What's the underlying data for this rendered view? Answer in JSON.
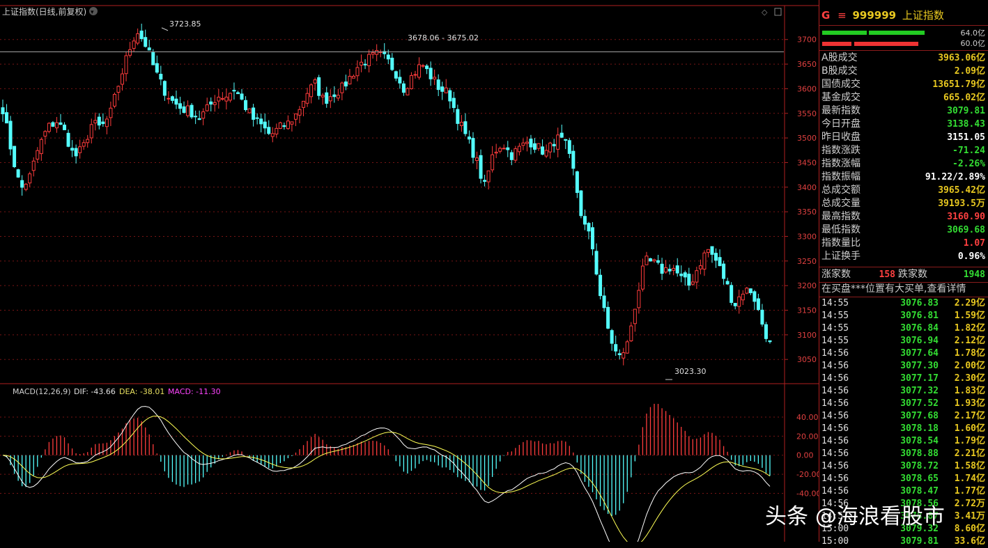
{
  "chart_header": {
    "title": "上证指数(日线,前复权)",
    "price_labels": {
      "high": "3723.85",
      "range": "3678.06 - 3675.02",
      "low": "3023.30"
    }
  },
  "macd_header": {
    "name": "MACD(12,26,9)",
    "dif": "DIF: -43.66",
    "dea": "DEA: -38.01",
    "macd": "MACD: -11.30"
  },
  "colors": {
    "up": "#ff3c3c",
    "down": "#54ffff",
    "dif": "#ffffff",
    "dea": "#ffff55",
    "grid": "#7a1515",
    "macd_label": "#ff44ff"
  },
  "chart_data": [
    {
      "type": "candlestick",
      "title": "上证指数(日线,前复权)",
      "y_ticks": [
        3050,
        3100,
        3150,
        3200,
        3250,
        3300,
        3350,
        3400,
        3450,
        3500,
        3550,
        3600,
        3650,
        3700
      ],
      "ylim": [
        3005,
        3735
      ],
      "annotations": {
        "high": 3723.85,
        "low": 3023.3,
        "reference": 3675.02
      },
      "close_path": [
        3560,
        3470,
        3395,
        3420,
        3480,
        3520,
        3535,
        3510,
        3460,
        3480,
        3530,
        3520,
        3545,
        3610,
        3670,
        3720,
        3690,
        3640,
        3600,
        3575,
        3560,
        3555,
        3540,
        3560,
        3585,
        3585,
        3600,
        3570,
        3540,
        3525,
        3505,
        3520,
        3530,
        3550,
        3590,
        3610,
        3575,
        3590,
        3600,
        3625,
        3650,
        3660,
        3670,
        3660,
        3635,
        3600,
        3630,
        3650,
        3625,
        3600,
        3590,
        3540,
        3500,
        3460,
        3400,
        3470,
        3490,
        3465,
        3480,
        3495,
        3480,
        3470,
        3500,
        3490,
        3430,
        3330,
        3290,
        3180,
        3100,
        3050,
        3080,
        3170,
        3250,
        3245,
        3230,
        3240,
        3215,
        3200,
        3240,
        3275,
        3250,
        3210,
        3160,
        3190,
        3190,
        3130,
        3080
      ]
    },
    {
      "type": "macd",
      "name": "MACD(12,26,9)",
      "y_ticks": [
        40,
        20,
        0,
        -20,
        -40
      ],
      "ylim": [
        -85,
        70
      ],
      "dif_last": -43.66,
      "dea_last": -38.01,
      "macd_last": -11.3
    }
  ],
  "panel": {
    "code_prefix": "G",
    "code": "999999",
    "name": "上证指数",
    "bar_values": [
      "64.0亿",
      "60.0亿"
    ],
    "stats": [
      {
        "label": "A股成交",
        "value": "3963.06亿",
        "color": "#e8c820"
      },
      {
        "label": "B股成交",
        "value": "2.09亿",
        "color": "#e8c820"
      },
      {
        "label": "国债成交",
        "value": "13651.79亿",
        "color": "#e8c820"
      },
      {
        "label": "基金成交",
        "value": "665.02亿",
        "color": "#e8c820"
      },
      {
        "label": "最新指数",
        "value": "3079.81",
        "color": "#33dd33"
      },
      {
        "label": "今日开盘",
        "value": "3138.43",
        "color": "#33dd33"
      },
      {
        "label": "昨日收盘",
        "value": "3151.05",
        "color": "#ffffff"
      },
      {
        "label": "指数涨跌",
        "value": "-71.24",
        "color": "#33dd33"
      },
      {
        "label": "指数涨幅",
        "value": "-2.26%",
        "color": "#33dd33"
      },
      {
        "label": "指数振幅",
        "value": "91.22/2.89%",
        "color": "#ffffff"
      },
      {
        "label": "总成交额",
        "value": "3965.42亿",
        "color": "#e8c820"
      },
      {
        "label": "总成交量",
        "value": "39193.5万",
        "color": "#e8c820"
      },
      {
        "label": "最高指数",
        "value": "3160.90",
        "color": "#ff4040"
      },
      {
        "label": "最低指数",
        "value": "3069.68",
        "color": "#33dd33"
      },
      {
        "label": "指数量比",
        "value": "1.07",
        "color": "#ff4040"
      },
      {
        "label": "上证换手",
        "value": "0.96%",
        "color": "#ffffff"
      }
    ],
    "rise_label": "涨家数",
    "rise_value": "158",
    "fall_label": "跌家数",
    "fall_value": "1948",
    "notice": "在买盘***位置有大买单,查看详情",
    "ticks": [
      {
        "time": "14:55",
        "price": "3076.83",
        "vol": "2.29亿"
      },
      {
        "time": "14:55",
        "price": "3076.81",
        "vol": "1.59亿"
      },
      {
        "time": "14:55",
        "price": "3076.84",
        "vol": "1.82亿"
      },
      {
        "time": "14:55",
        "price": "3076.94",
        "vol": "2.12亿"
      },
      {
        "time": "14:56",
        "price": "3077.64",
        "vol": "1.78亿"
      },
      {
        "time": "14:56",
        "price": "3077.30",
        "vol": "2.00亿"
      },
      {
        "time": "14:56",
        "price": "3077.17",
        "vol": "2.30亿"
      },
      {
        "time": "14:56",
        "price": "3077.32",
        "vol": "1.83亿"
      },
      {
        "time": "14:56",
        "price": "3077.52",
        "vol": "1.93亿"
      },
      {
        "time": "14:56",
        "price": "3077.68",
        "vol": "2.17亿"
      },
      {
        "time": "14:56",
        "price": "3078.18",
        "vol": "1.60亿"
      },
      {
        "time": "14:56",
        "price": "3078.54",
        "vol": "1.79亿"
      },
      {
        "time": "14:56",
        "price": "3078.88",
        "vol": "2.21亿"
      },
      {
        "time": "14:56",
        "price": "3078.72",
        "vol": "1.58亿"
      },
      {
        "time": "14:56",
        "price": "3078.65",
        "vol": "1.74亿"
      },
      {
        "time": "14:56",
        "price": "3078.47",
        "vol": "1.77亿"
      },
      {
        "time": "14:56",
        "price": "3078.56",
        "vol": "2.72万"
      },
      {
        "time": "14:57",
        "price": "3078.87",
        "vol": "3.41万"
      },
      {
        "time": "15:00",
        "price": "3079.32",
        "vol": "8.60亿"
      },
      {
        "time": "15:00",
        "price": "3079.81",
        "vol": "33.6亿"
      }
    ]
  },
  "watermark": "头条 @海浪看股市"
}
